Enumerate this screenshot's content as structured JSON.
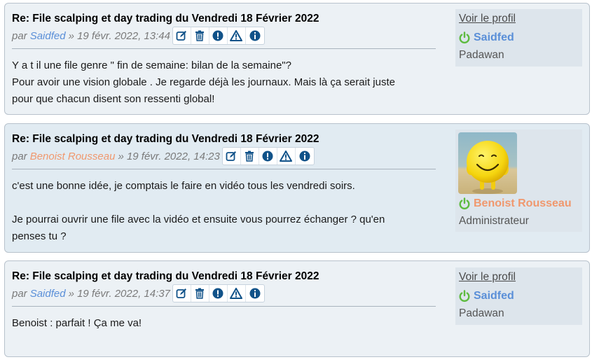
{
  "posts": [
    {
      "title": "Re: File scalping et day trading du Vendredi 18 Février 2022",
      "by": "par",
      "author": "Saidfed",
      "date": "» 19 févr. 2022, 13:44",
      "content": [
        "Y a t il une file genre \" fin de semaine: bilan de la semaine\"?",
        "Pour avoir une vision globale . Je regarde déjà les journaux. Mais là ça serait juste",
        "pour que chacun disent son ressenti global!"
      ],
      "profile": {
        "view_label": "Voir le profil",
        "username": "Saidfed",
        "rank": "Padawan"
      }
    },
    {
      "title": "Re: File scalping et day trading du Vendredi 18 Février 2022",
      "by": "par",
      "author": "Benoist Rousseau",
      "date": "» 19 févr. 2022, 14:23",
      "content": [
        "c'est une bonne idée, je comptais le faire en vidéo tous les vendredi soirs.",
        "Je pourrai ouvrir une file avec la vidéo et ensuite vous pourrez échanger ? qu'en",
        "penses tu ?"
      ],
      "profile": {
        "username": "Benoist Rousseau",
        "rank": "Administrateur"
      }
    },
    {
      "title": "Re: File scalping et day trading du Vendredi 18 Février 2022",
      "by": "par",
      "author": "Saidfed",
      "date": "» 19 févr. 2022, 14:37",
      "content": [
        "Benoist : parfait ! Ça me va!"
      ],
      "profile": {
        "view_label": "Voir le profil",
        "username": "Saidfed",
        "rank": "Padawan"
      }
    }
  ],
  "action_icons": [
    "edit-icon",
    "delete-icon",
    "warning-icon",
    "report-icon",
    "info-icon"
  ],
  "colors": {
    "user": "#5a8fd8",
    "admin": "#f0986e",
    "online": "#5dbb3f",
    "icon": "#105289"
  }
}
